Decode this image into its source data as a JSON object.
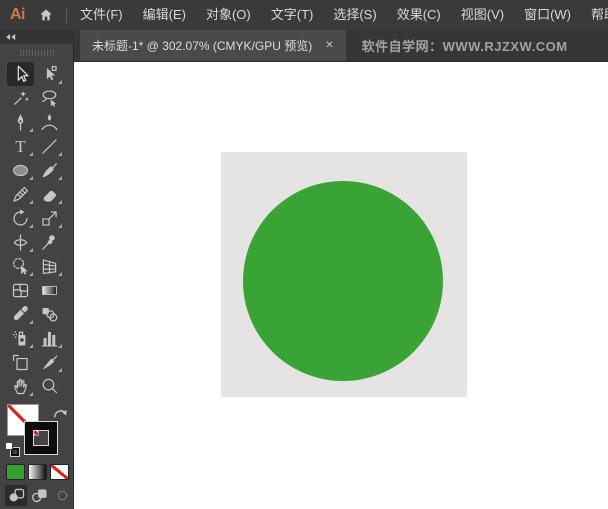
{
  "app": {
    "logo_text": "Ai"
  },
  "menubar": {
    "items": [
      "文件(F)",
      "编辑(E)",
      "对象(O)",
      "文字(T)",
      "选择(S)",
      "效果(C)",
      "视图(V)",
      "窗口(W)",
      "帮助(H)"
    ]
  },
  "tabbar": {
    "document_tab": "未标题-1* @ 302.07% (CMYK/GPU 预览)",
    "document_name": "未标题-1*",
    "zoom_level": "302.07%",
    "color_mode": "CMYK/GPU 预览",
    "close_glyph": "✕",
    "watermark": "软件自学网：WWW.RJZXW.COM"
  },
  "toolbar": {
    "selected_tool": "selection",
    "tools": [
      {
        "name": "selection",
        "flyout": false,
        "selected": true
      },
      {
        "name": "direct-selection",
        "flyout": true
      },
      {
        "name": "magic-wand",
        "flyout": false
      },
      {
        "name": "lasso",
        "flyout": false
      },
      {
        "name": "pen",
        "flyout": true
      },
      {
        "name": "curvature-pen",
        "flyout": false
      },
      {
        "name": "type",
        "flyout": true
      },
      {
        "name": "line-segment",
        "flyout": true
      },
      {
        "name": "ellipse",
        "flyout": true
      },
      {
        "name": "paintbrush",
        "flyout": true
      },
      {
        "name": "shaper-pencil",
        "flyout": true
      },
      {
        "name": "eraser",
        "flyout": true
      },
      {
        "name": "rotate",
        "flyout": true
      },
      {
        "name": "scale",
        "flyout": true
      },
      {
        "name": "width",
        "flyout": true
      },
      {
        "name": "puppet-warp",
        "flyout": false
      },
      {
        "name": "shape-builder",
        "flyout": true
      },
      {
        "name": "perspective-grid",
        "flyout": true
      },
      {
        "name": "mesh",
        "flyout": false
      },
      {
        "name": "gradient",
        "flyout": false
      },
      {
        "name": "eyedropper",
        "flyout": true
      },
      {
        "name": "blend",
        "flyout": false
      },
      {
        "name": "symbol-sprayer",
        "flyout": true
      },
      {
        "name": "column-graph",
        "flyout": true
      },
      {
        "name": "artboard",
        "flyout": false
      },
      {
        "name": "slice",
        "flyout": true
      },
      {
        "name": "hand",
        "flyout": true
      },
      {
        "name": "zoom",
        "flyout": false
      }
    ],
    "fill_swatch": "none",
    "stroke_swatch": "black",
    "color_buttons": [
      {
        "name": "fill-color",
        "color": "#31a22f"
      },
      {
        "name": "gradient"
      },
      {
        "name": "none"
      }
    ],
    "drawing_modes": [
      {
        "name": "draw-normal",
        "active": true,
        "disabled": false
      },
      {
        "name": "draw-behind",
        "active": false,
        "disabled": false
      },
      {
        "name": "draw-inside",
        "active": false,
        "disabled": true
      }
    ]
  },
  "canvas": {
    "artboard_color": "#e5e4e2",
    "circle_color": "#39a336"
  },
  "colors": {
    "menubar_bg": "#3a3a3a",
    "toolbar_bg": "#434343",
    "tabbar_bg": "#363636",
    "tab_active_bg": "#4a4a4a",
    "logo": "#cb7b52",
    "none_red": "#e02020"
  }
}
